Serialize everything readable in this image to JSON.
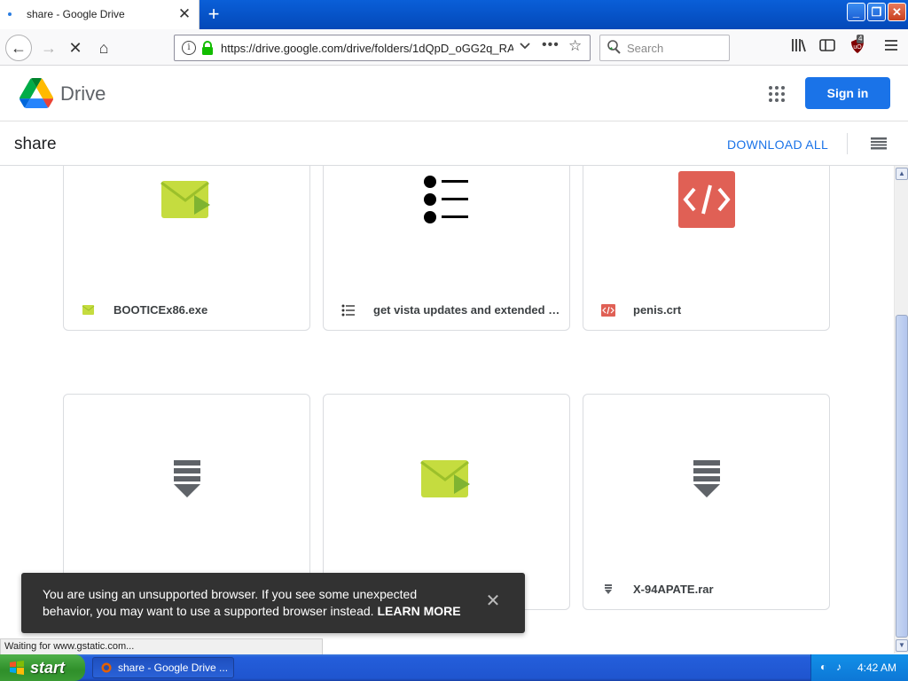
{
  "browser": {
    "tab": {
      "title": "share - Google Drive",
      "close": "✕"
    },
    "new_tab": "+",
    "window": {
      "minimize": "_",
      "maximize": "❐",
      "close": "✕"
    },
    "nav": {
      "back": "←",
      "forward": "→",
      "stop": "✕",
      "home": "⌂"
    },
    "url": "https://drive.google.com/drive/folders/1dQpD_oGG2q_RA",
    "search_placeholder": "Search",
    "overflow": "•••",
    "bookmark": "☆",
    "ublock_badge": "4",
    "status_text": "Waiting for www.gstatic.com..."
  },
  "drive": {
    "app_name": "Drive",
    "sign_in_label": "Sign in",
    "folder_title": "share",
    "download_all_label": "DOWNLOAD ALL",
    "files": [
      {
        "name": "BOOTICEx86.exe",
        "icon": "exe-icon"
      },
      {
        "name": "get vista updates and extended kernel",
        "icon": "list-icon"
      },
      {
        "name": "penis.crt",
        "icon": "code-icon"
      },
      {
        "name": "",
        "icon": "archive-icon"
      },
      {
        "name": "",
        "icon": "exe-icon"
      },
      {
        "name": "X-94APATE.rar",
        "icon": "archive-icon"
      }
    ],
    "toast": {
      "message": "You are using an unsupported browser. If you see some unexpected behavior, you may want to use a supported browser instead.",
      "link": "LEARN MORE",
      "close": "✕"
    }
  },
  "colors": {
    "accent": "#1a73e8",
    "code_red": "#e06055",
    "exe_green": "#c5dc3f"
  },
  "taskbar": {
    "start_label": "start",
    "task_title": "share - Google Drive ...",
    "clock": "4:42 AM"
  }
}
